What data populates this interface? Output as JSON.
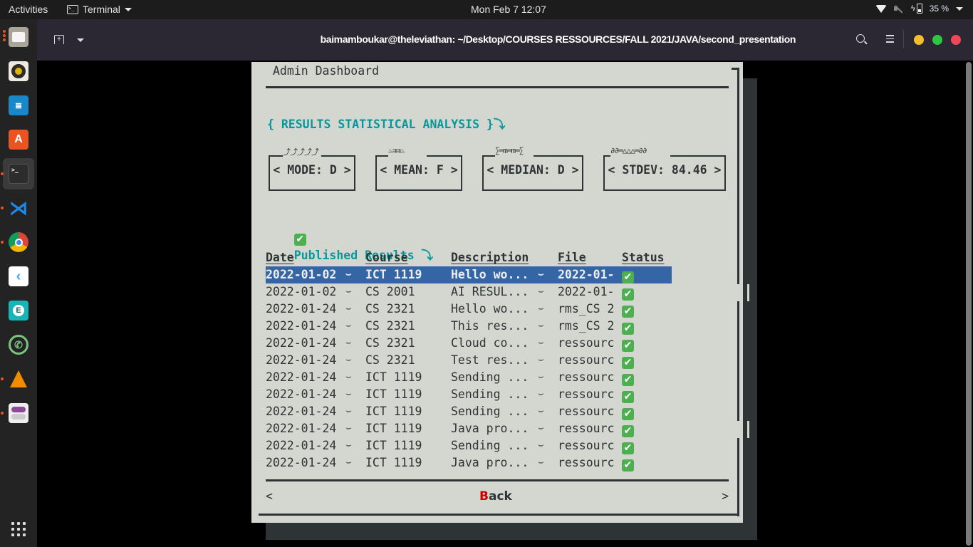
{
  "topbar": {
    "activities": "Activities",
    "app_name": "Terminal",
    "clock": "Mon Feb 7  12:07",
    "battery": "35 %"
  },
  "dock": {
    "items": [
      {
        "name": "files",
        "running": true
      },
      {
        "name": "rhythmbox",
        "running": false
      },
      {
        "name": "libreoffice-writer",
        "running": false
      },
      {
        "name": "ubuntu-software",
        "running": false
      },
      {
        "name": "terminal",
        "running": true,
        "active": true
      },
      {
        "name": "vscode",
        "running": true
      },
      {
        "name": "chrome",
        "running": true
      },
      {
        "name": "flutter",
        "running": false
      },
      {
        "name": "app-e",
        "running": false
      },
      {
        "name": "whatsapp",
        "running": false
      },
      {
        "name": "vlc",
        "running": true
      },
      {
        "name": "tweaks",
        "running": true
      }
    ]
  },
  "terminal": {
    "title": "baimamboukar@theleviathan: ~/Desktop/COURSES RESSOURCES/FALL 2021/JAVA/second_presentation",
    "buttons": {
      "minimize": "#f5bf2a",
      "maximize": "#2bc840",
      "close": "#f0465a"
    }
  },
  "dialog": {
    "title": "Admin Dashboard",
    "analysis_title": "{ RESULTS STATISTICAL ANALYSIS }⤵",
    "stats": [
      {
        "label": "< MODE: D >",
        "deco": "⤴⤴⤴⤴⤴"
      },
      {
        "label": "< MEAN: F >",
        "deco": "♨⇉⇉♨"
      },
      {
        "label": "< MEDIAN: D >",
        "deco": "∑═m═m═∑"
      },
      {
        "label": "< STDEV: 84.46 >",
        "deco": "∂∂═△△△═∂∂"
      }
    ],
    "published_title": "Published Results ⤵",
    "table": {
      "headers": [
        "Date",
        "Course",
        "Description",
        "File",
        "Status"
      ],
      "rows": [
        {
          "date": "2022-01-02",
          "course": "ICT 1119",
          "description": "Hello wo...",
          "file": "2022-01-",
          "status": "✔",
          "selected": true
        },
        {
          "date": "2022-01-02",
          "course": "CS 2001",
          "description": "AI RESUL...",
          "file": "2022-01-",
          "status": "✔"
        },
        {
          "date": "2022-01-24",
          "course": "CS 2321",
          "description": "Hello wo...",
          "file": "rms_CS 2",
          "status": "✔"
        },
        {
          "date": "2022-01-24",
          "course": "CS 2321",
          "description": "This res...",
          "file": "rms_CS 2",
          "status": "✔"
        },
        {
          "date": "2022-01-24",
          "course": "CS 2321",
          "description": "Cloud co...",
          "file": "ressourc",
          "status": "✔"
        },
        {
          "date": "2022-01-24",
          "course": "CS 2321",
          "description": "Test res...",
          "file": "ressourc",
          "status": "✔"
        },
        {
          "date": "2022-01-24",
          "course": "ICT 1119",
          "description": "Sending ...",
          "file": "ressourc",
          "status": "✔"
        },
        {
          "date": "2022-01-24",
          "course": "ICT 1119",
          "description": "Sending ...",
          "file": "ressourc",
          "status": "✔"
        },
        {
          "date": "2022-01-24",
          "course": "ICT 1119",
          "description": "Sending ...",
          "file": "ressourc",
          "status": "✔"
        },
        {
          "date": "2022-01-24",
          "course": "ICT 1119",
          "description": "Java pro...",
          "file": "ressourc",
          "status": "✔"
        },
        {
          "date": "2022-01-24",
          "course": "ICT 1119",
          "description": "Sending ...",
          "file": "ressourc",
          "status": "✔"
        },
        {
          "date": "2022-01-24",
          "course": "ICT 1119",
          "description": "Java pro...",
          "file": "ressourc",
          "status": "✔"
        }
      ],
      "separator": "⌣"
    },
    "footer": {
      "prev": "<",
      "next": ">",
      "back_hotkey": "B",
      "back_rest": "ack"
    }
  },
  "colors": {
    "dialog_bg": "#d3d7cf",
    "accent_cyan": "#06989a",
    "selection": "#3465a4",
    "hotkey_red": "#cc0000"
  }
}
